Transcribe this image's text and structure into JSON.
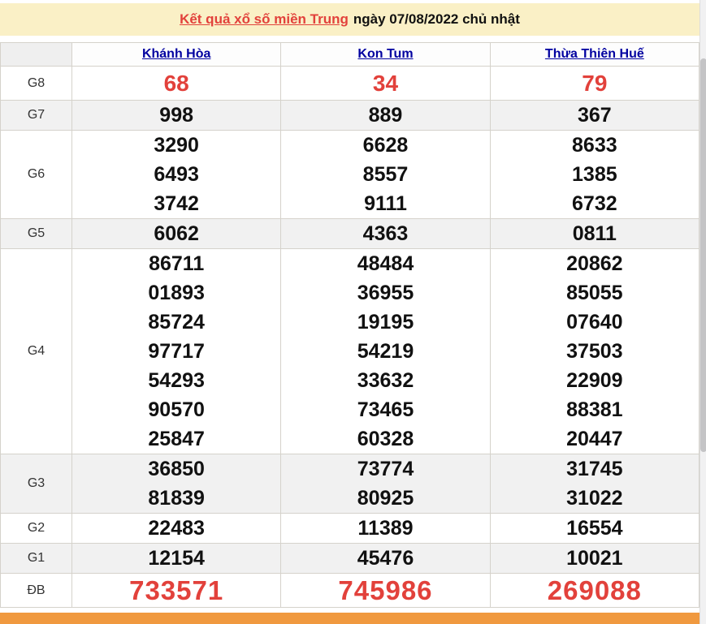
{
  "header": {
    "title_link": "Kết quả xổ số miền Trung",
    "title_suffix": "ngày 07/08/2022 chủ nhật"
  },
  "table": {
    "columns": [
      "Khánh Hòa",
      "Kon Tum",
      "Thừa Thiên Huế"
    ],
    "rows": [
      {
        "label": "G8",
        "style": "g8",
        "values": [
          [
            "68"
          ],
          [
            "34"
          ],
          [
            "79"
          ]
        ]
      },
      {
        "label": "G7",
        "style": "normal",
        "values": [
          [
            "998"
          ],
          [
            "889"
          ],
          [
            "367"
          ]
        ]
      },
      {
        "label": "G6",
        "style": "normal",
        "values": [
          [
            "3290",
            "6493",
            "3742"
          ],
          [
            "6628",
            "8557",
            "9111"
          ],
          [
            "8633",
            "1385",
            "6732"
          ]
        ]
      },
      {
        "label": "G5",
        "style": "normal",
        "values": [
          [
            "6062"
          ],
          [
            "4363"
          ],
          [
            "0811"
          ]
        ]
      },
      {
        "label": "G4",
        "style": "normal",
        "values": [
          [
            "86711",
            "01893",
            "85724",
            "97717",
            "54293",
            "90570",
            "25847"
          ],
          [
            "48484",
            "36955",
            "19195",
            "54219",
            "33632",
            "73465",
            "60328"
          ],
          [
            "20862",
            "85055",
            "07640",
            "37503",
            "22909",
            "88381",
            "20447"
          ]
        ]
      },
      {
        "label": "G3",
        "style": "normal",
        "values": [
          [
            "36850",
            "81839"
          ],
          [
            "73774",
            "80925"
          ],
          [
            "31745",
            "31022"
          ]
        ]
      },
      {
        "label": "G2",
        "style": "normal",
        "values": [
          [
            "22483"
          ],
          [
            "11389"
          ],
          [
            "16554"
          ]
        ]
      },
      {
        "label": "G1",
        "style": "normal",
        "values": [
          [
            "12154"
          ],
          [
            "45476"
          ],
          [
            "10021"
          ]
        ]
      },
      {
        "label": "ĐB",
        "style": "db",
        "values": [
          [
            "733571"
          ],
          [
            "745986"
          ],
          [
            "269088"
          ]
        ]
      }
    ]
  },
  "colors": {
    "accent_red": "#e2413b",
    "link_blue": "#0000a0",
    "header_band_bg": "#faf0c6",
    "stripe_gray": "#f1f1f1",
    "bottom_bar_orange": "#f0993f",
    "border_gray": "#d5d2cb"
  }
}
